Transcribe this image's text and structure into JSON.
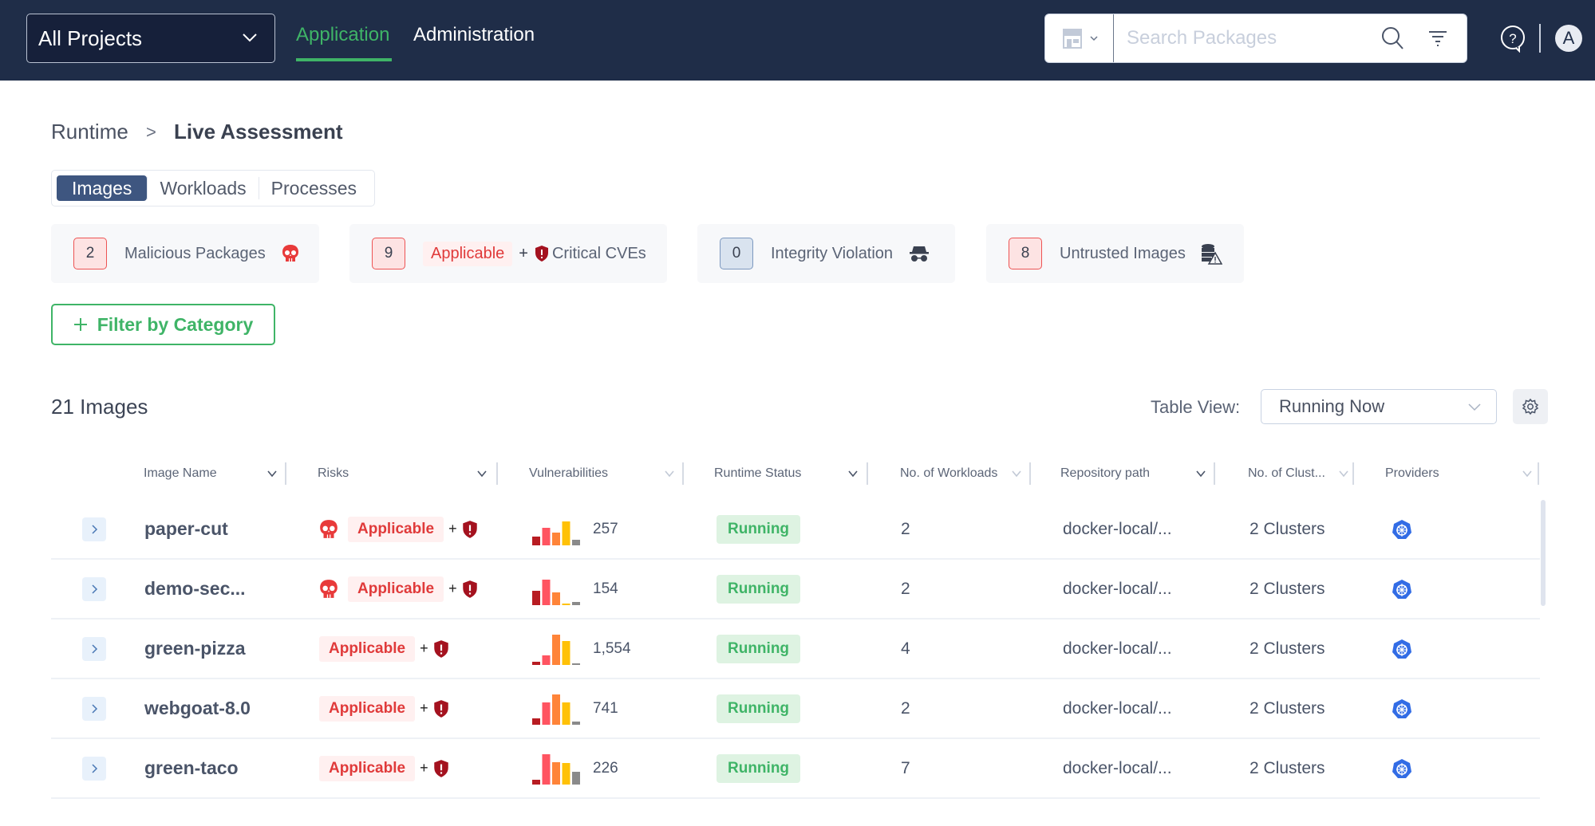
{
  "header": {
    "project_selector": "All Projects",
    "nav": [
      {
        "label": "Application",
        "active": true
      },
      {
        "label": "Administration",
        "active": false
      }
    ],
    "search": {
      "placeholder": "Search Packages",
      "value": ""
    },
    "avatar_initial": "A",
    "icons": {
      "store": "store-icon",
      "search": "search-icon",
      "filter": "filter-icon",
      "help": "help-icon"
    }
  },
  "breadcrumb": {
    "parent": "Runtime",
    "separator": ">",
    "current": "Live Assessment"
  },
  "tabs": [
    {
      "label": "Images",
      "active": true
    },
    {
      "label": "Workloads",
      "active": false
    },
    {
      "label": "Processes",
      "active": false
    }
  ],
  "summary_cards": [
    {
      "count": "2",
      "label": "Malicious Packages",
      "icon": "skull-icon",
      "style": "red"
    },
    {
      "count": "9",
      "tag": "Applicable",
      "plus": "+",
      "label": "Critical CVEs",
      "icon": "shield-alert-icon",
      "style": "red"
    },
    {
      "count": "0",
      "label": "Integrity Violation",
      "icon": "incognito-icon",
      "style": "blue"
    },
    {
      "count": "8",
      "label": "Untrusted Images",
      "icon": "database-warning-icon",
      "style": "red"
    }
  ],
  "filter_button": {
    "label": "Filter by Category",
    "icon": "plus-icon"
  },
  "images_count": "21 Images",
  "table_view": {
    "label": "Table View:",
    "selected": "Running Now"
  },
  "colors": {
    "header_bg": "#1f2d48",
    "accent_green": "#3fb467",
    "danger_red": "#e03a3a",
    "vuln_critical": "#b81c22",
    "vuln_high": "#ff5461",
    "vuln_medium": "#ff8439",
    "vuln_low": "#ffc107",
    "vuln_unknown": "#8a8a8a",
    "k8s_blue": "#326ce5"
  },
  "table": {
    "columns": [
      "Image Name",
      "Risks",
      "Vulnerabilities",
      "Runtime Status",
      "No. of Workloads",
      "Repository path",
      "No. of Clust...",
      "Providers"
    ],
    "rows": [
      {
        "name": "paper-cut",
        "malicious": true,
        "risk": "Applicable",
        "plus": "+",
        "vuln_total": "257",
        "vuln_dist": [
          0.28,
          0.55,
          0.4,
          0.75,
          0.18
        ],
        "status": "Running",
        "workloads": "2",
        "repo": "docker-local/...",
        "clusters": "2 Clusters",
        "provider": "kubernetes"
      },
      {
        "name": "demo-sec...",
        "malicious": true,
        "risk": "Applicable",
        "plus": "+",
        "vuln_total": "154",
        "vuln_dist": [
          0.45,
          0.8,
          0.4,
          0.05,
          0.1
        ],
        "status": "Running",
        "workloads": "2",
        "repo": "docker-local/...",
        "clusters": "2 Clusters",
        "provider": "kubernetes"
      },
      {
        "name": "green-pizza",
        "malicious": false,
        "risk": "Applicable",
        "plus": "+",
        "vuln_total": "1,554",
        "vuln_dist": [
          0.1,
          0.3,
          0.95,
          0.75,
          0.03
        ],
        "status": "Running",
        "workloads": "4",
        "repo": "docker-local/...",
        "clusters": "2 Clusters",
        "provider": "kubernetes"
      },
      {
        "name": "webgoat-8.0",
        "malicious": false,
        "risk": "Applicable",
        "plus": "+",
        "vuln_total": "741",
        "vuln_dist": [
          0.2,
          0.7,
          0.95,
          0.7,
          0.1
        ],
        "status": "Running",
        "workloads": "2",
        "repo": "docker-local/...",
        "clusters": "2 Clusters",
        "provider": "kubernetes"
      },
      {
        "name": "green-taco",
        "malicious": false,
        "risk": "Applicable",
        "plus": "+",
        "vuln_total": "226",
        "vuln_dist": [
          0.15,
          0.95,
          0.7,
          0.68,
          0.4
        ],
        "status": "Running",
        "workloads": "7",
        "repo": "docker-local/...",
        "clusters": "2 Clusters",
        "provider": "kubernetes"
      }
    ]
  }
}
